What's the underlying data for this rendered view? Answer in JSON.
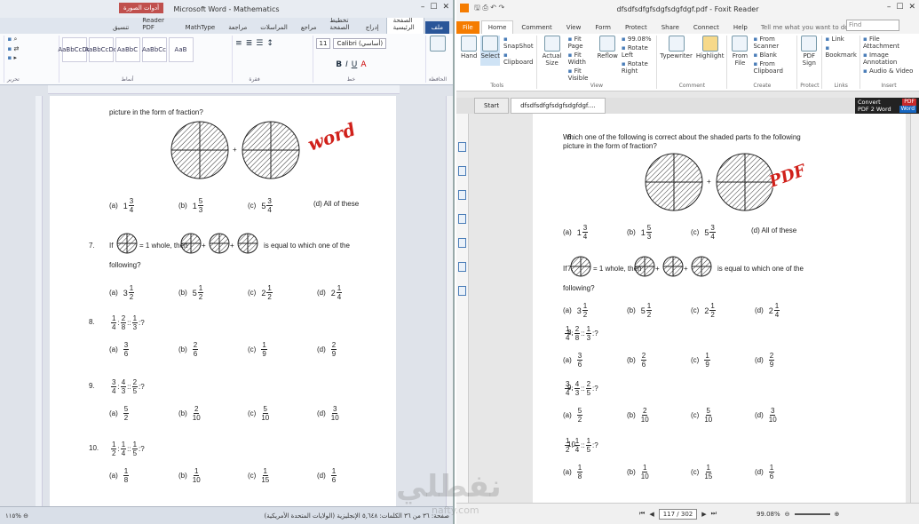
{
  "word": {
    "title": "Microsoft Word - Mathematics",
    "context_tab": "أدوات الصورة",
    "context_subtab": "تنسيق",
    "tabs": [
      "Foxit Reader PDF",
      "MathType",
      "مراجعة",
      "المراسلات",
      "مراجع",
      "تخطيط الصفحة",
      "إدراج",
      "الصفحة الرئيسية",
      "ملف"
    ],
    "styles": [
      "AaBbCcDc",
      "AaBbCcDc",
      "AaBbC",
      "AaBbCc",
      "AaB"
    ],
    "group_labels": [
      "تحرير",
      "أنماط",
      "فقرة",
      "خط",
      "الحافظة"
    ],
    "font_name": "Calibri (أساسي)",
    "font_size": "11",
    "stamp": "word",
    "status_left": "١١٥% ⊖",
    "status_right": "صفحة: ٣٦ من ٣٦   الكلمات: ٥,٦٤٨   الإنجليزية (الولايات المتحدة الأمريكية)"
  },
  "foxit": {
    "title": "dfsdfsdfgfsdgfsdgfdgf.pdf - Foxit Reader",
    "tabs": [
      "File",
      "Home",
      "Comment",
      "View",
      "Form",
      "Protect",
      "Share",
      "Connect",
      "Help"
    ],
    "tell_me": "Tell me what you want to do...",
    "find_placeholder": "Find",
    "tools": {
      "hand": "Hand",
      "select": "Select",
      "snapshot": "SnapShot",
      "clipboard": "Clipboard",
      "label": "Tools"
    },
    "view": {
      "actual_size": "Actual Size",
      "fit_page": "Fit Page",
      "fit_width": "Fit Width",
      "fit_visible": "Fit Visible",
      "zoom": "99.08%",
      "rotate_left": "Rotate Left",
      "rotate_right": "Rotate Right",
      "reflow": "Reflow",
      "label": "View"
    },
    "comment": {
      "typewriter": "Typewriter",
      "highlight": "Highlight",
      "label": "Comment"
    },
    "create": {
      "from_file": "From File",
      "from_scanner": "From Scanner",
      "blank": "Blank",
      "from_clipboard": "From Clipboard",
      "label": "Create"
    },
    "protect": {
      "pdf_sign": "PDF Sign",
      "label": "Protect"
    },
    "links": {
      "link": "Link",
      "bookmark": "Bookmark",
      "label": "Links"
    },
    "insert": {
      "file_attachment": "File Attachment",
      "image_annotation": "Image Annotation",
      "audio_video": "Audio & Video",
      "label": "Insert"
    },
    "doc_tabs": [
      "Start",
      "dfsdfsdfgfsdgfsdgfdgf...."
    ],
    "convert": {
      "line1": "Convert",
      "line2": "PDF 2 Word",
      "badge_pdf": "PDF",
      "badge_word": "Word"
    },
    "stamp": "PDF",
    "page_indicator": "117 / 302",
    "zoom_status": "99.08%"
  },
  "content": {
    "q5_tail": "picture in the form of fraction?",
    "q6_num": "6.",
    "q6_text1": "Which one of the following is correct about the shaded parts fo the following",
    "q6_text2": "picture in the form of fraction?",
    "q6_opts": [
      {
        "label": "(a)",
        "whole": "1",
        "num": "3",
        "den": "4"
      },
      {
        "label": "(b)",
        "whole": "1",
        "num": "5",
        "den": "3"
      },
      {
        "label": "(c)",
        "whole": "5",
        "num": "3",
        "den": "4"
      }
    ],
    "q6_d": "(d) All of these",
    "q7_num": "7.",
    "q7_if": "If",
    "q7_whole": "= 1 whole, then",
    "q7_plus": "+",
    "q7_tail": "is equal to which one of the",
    "q7_following": "following?",
    "q7_opts": [
      {
        "label": "(a)",
        "whole": "3",
        "num": "1",
        "den": "2"
      },
      {
        "label": "(b)",
        "whole": "5",
        "num": "1",
        "den": "2"
      },
      {
        "label": "(c)",
        "whole": "2",
        "num": "1",
        "den": "2"
      },
      {
        "label": "(d)",
        "whole": "2",
        "num": "1",
        "den": "4"
      }
    ],
    "q8_num": "8.",
    "q8_ratio": [
      [
        "1",
        "4"
      ],
      [
        "2",
        "8"
      ],
      [
        "1",
        "3"
      ]
    ],
    "q8_opts": [
      {
        "label": "(a)",
        "num": "3",
        "den": "6"
      },
      {
        "label": "(b)",
        "num": "2",
        "den": "6"
      },
      {
        "label": "(c)",
        "num": "1",
        "den": "9"
      },
      {
        "label": "(d)",
        "num": "2",
        "den": "9"
      }
    ],
    "q9_num": "9.",
    "q9_ratio": [
      [
        "3",
        "4"
      ],
      [
        "4",
        "3"
      ],
      [
        "2",
        "5"
      ]
    ],
    "q9_opts": [
      {
        "label": "(a)",
        "num": "5",
        "den": "2"
      },
      {
        "label": "(b)",
        "num": "2",
        "den": "10"
      },
      {
        "label": "(c)",
        "num": "5",
        "den": "10"
      },
      {
        "label": "(d)",
        "num": "3",
        "den": "10"
      }
    ],
    "q10_num": "10.",
    "q10_ratio": [
      [
        "1",
        "2"
      ],
      [
        "1",
        "4"
      ],
      [
        "1",
        "5"
      ]
    ],
    "q10_opts": [
      {
        "label": "(a)",
        "num": "1",
        "den": "8"
      },
      {
        "label": "(b)",
        "num": "1",
        "den": "10"
      },
      {
        "label": "(c)",
        "num": "1",
        "den": "15"
      },
      {
        "label": "(d)",
        "num": "1",
        "den": "6"
      }
    ],
    "colon": ":",
    "dcolon": "::",
    "qmark": ":?",
    "plus": "+"
  },
  "watermark": {
    "main": "نفطلي",
    "sub": "nafty.com"
  },
  "colors": {
    "word_blue": "#2a5699",
    "foxit_orange": "#f57c00",
    "stamp_red": "#d0201a"
  }
}
